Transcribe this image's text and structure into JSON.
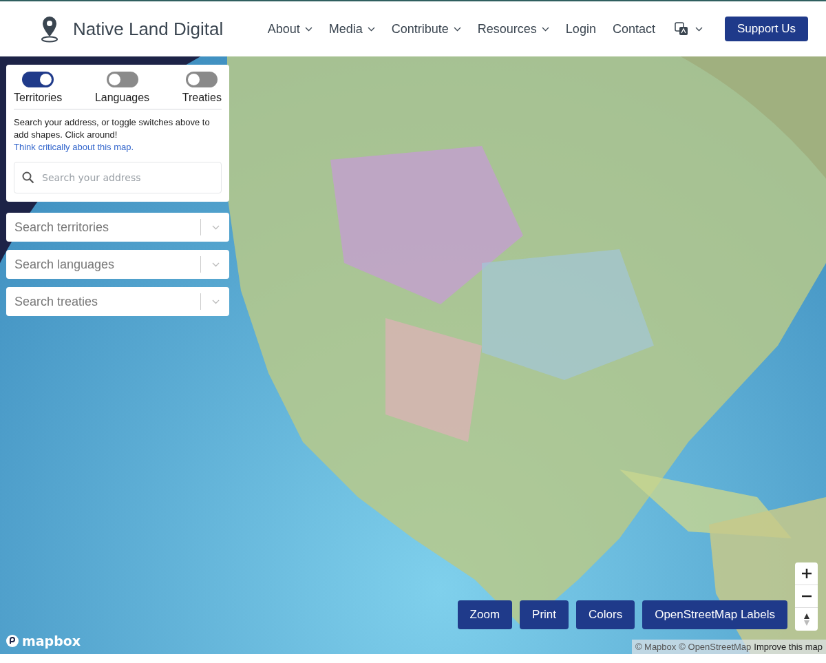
{
  "header": {
    "brand": "Native Land Digital",
    "nav": [
      {
        "label": "About",
        "dropdown": true
      },
      {
        "label": "Media",
        "dropdown": true
      },
      {
        "label": "Contribute",
        "dropdown": true
      },
      {
        "label": "Resources",
        "dropdown": true
      },
      {
        "label": "Login",
        "dropdown": false
      },
      {
        "label": "Contact",
        "dropdown": false
      }
    ],
    "support_button": "Support Us"
  },
  "panel": {
    "toggles": [
      {
        "label": "Territories",
        "on": true
      },
      {
        "label": "Languages",
        "on": false
      },
      {
        "label": "Treaties",
        "on": false
      }
    ],
    "intro": "Search your address, or toggle switches above to add shapes. Click around!",
    "intro_link": "Think critically about this map.",
    "address_search": {
      "placeholder": "Search your address"
    }
  },
  "selects": [
    {
      "placeholder": "Search territories"
    },
    {
      "placeholder": "Search languages"
    },
    {
      "placeholder": "Search treaties"
    }
  ],
  "map_buttons": [
    "Zoom",
    "Print",
    "Colors",
    "OpenStreetMap Labels"
  ],
  "logo": "mapbox",
  "attribution": {
    "links": [
      "© Mapbox",
      "© OpenStreetMap"
    ],
    "improve": "Improve this map"
  }
}
